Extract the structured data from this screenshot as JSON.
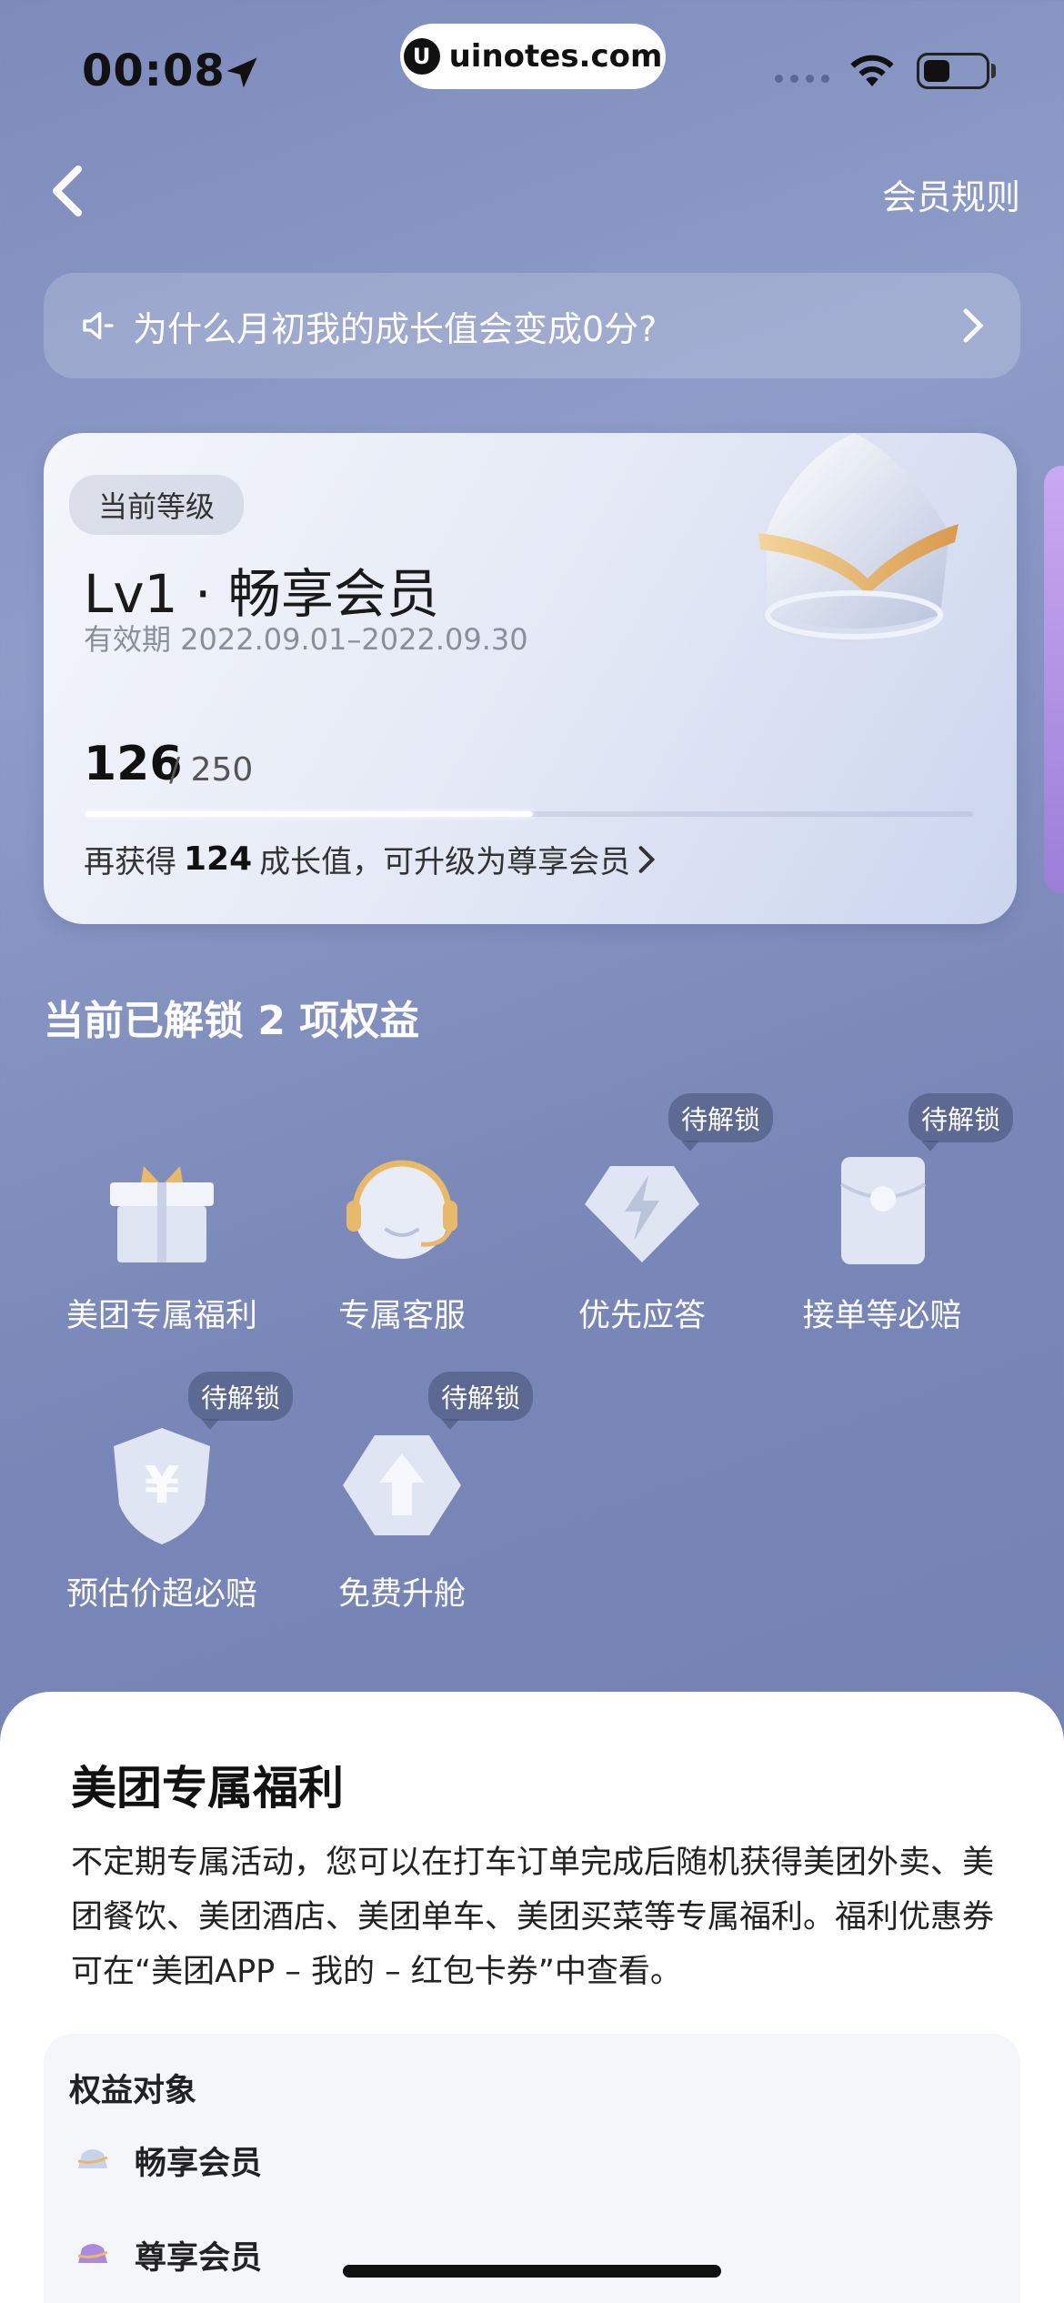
{
  "status": {
    "time": "00:08",
    "watermark": "uinotes.com"
  },
  "nav": {
    "rules_label": "会员规则"
  },
  "notice": {
    "text": "为什么月初我的成长值会变成0分?"
  },
  "level_card": {
    "badge": "当前等级",
    "title": "Lv1 · 畅享会员",
    "validity": "有效期 2022.09.01–2022.09.30",
    "current": "126",
    "total": "/ 250",
    "progress_fraction": 0.504,
    "upgrade_prefix": "再获得",
    "upgrade_value": "124",
    "upgrade_suffix": "成长值，可升级为尊享会员"
  },
  "benefits": {
    "title": "当前已解锁 2 项权益",
    "lock_label": "待解锁",
    "items": [
      {
        "label": "美团专属福利",
        "icon": "gift-icon",
        "locked": false
      },
      {
        "label": "专属客服",
        "icon": "headset-icon",
        "locked": false
      },
      {
        "label": "优先应答",
        "icon": "lightning-icon",
        "locked": true
      },
      {
        "label": "接单等必赔",
        "icon": "envelope-icon",
        "locked": true
      },
      {
        "label": "预估价超必赔",
        "icon": "yuan-shield-icon",
        "locked": true
      },
      {
        "label": "免费升舱",
        "icon": "upgrade-arrow-icon",
        "locked": true
      }
    ]
  },
  "sheet": {
    "title": "美团专属福利",
    "description": "不定期专属活动，您可以在打车订单完成后随机获得美团外卖、美团餐饮、美团酒店、美团单车、美团买菜等专属福利。福利优惠券可在“美团APP – 我的 – 红包卡券”中查看。",
    "audience_title": "权益对象",
    "audience": [
      {
        "label": "畅享会员",
        "color": "#c8d2ea"
      },
      {
        "label": "尊享会员",
        "color": "#a98ae0"
      }
    ]
  }
}
